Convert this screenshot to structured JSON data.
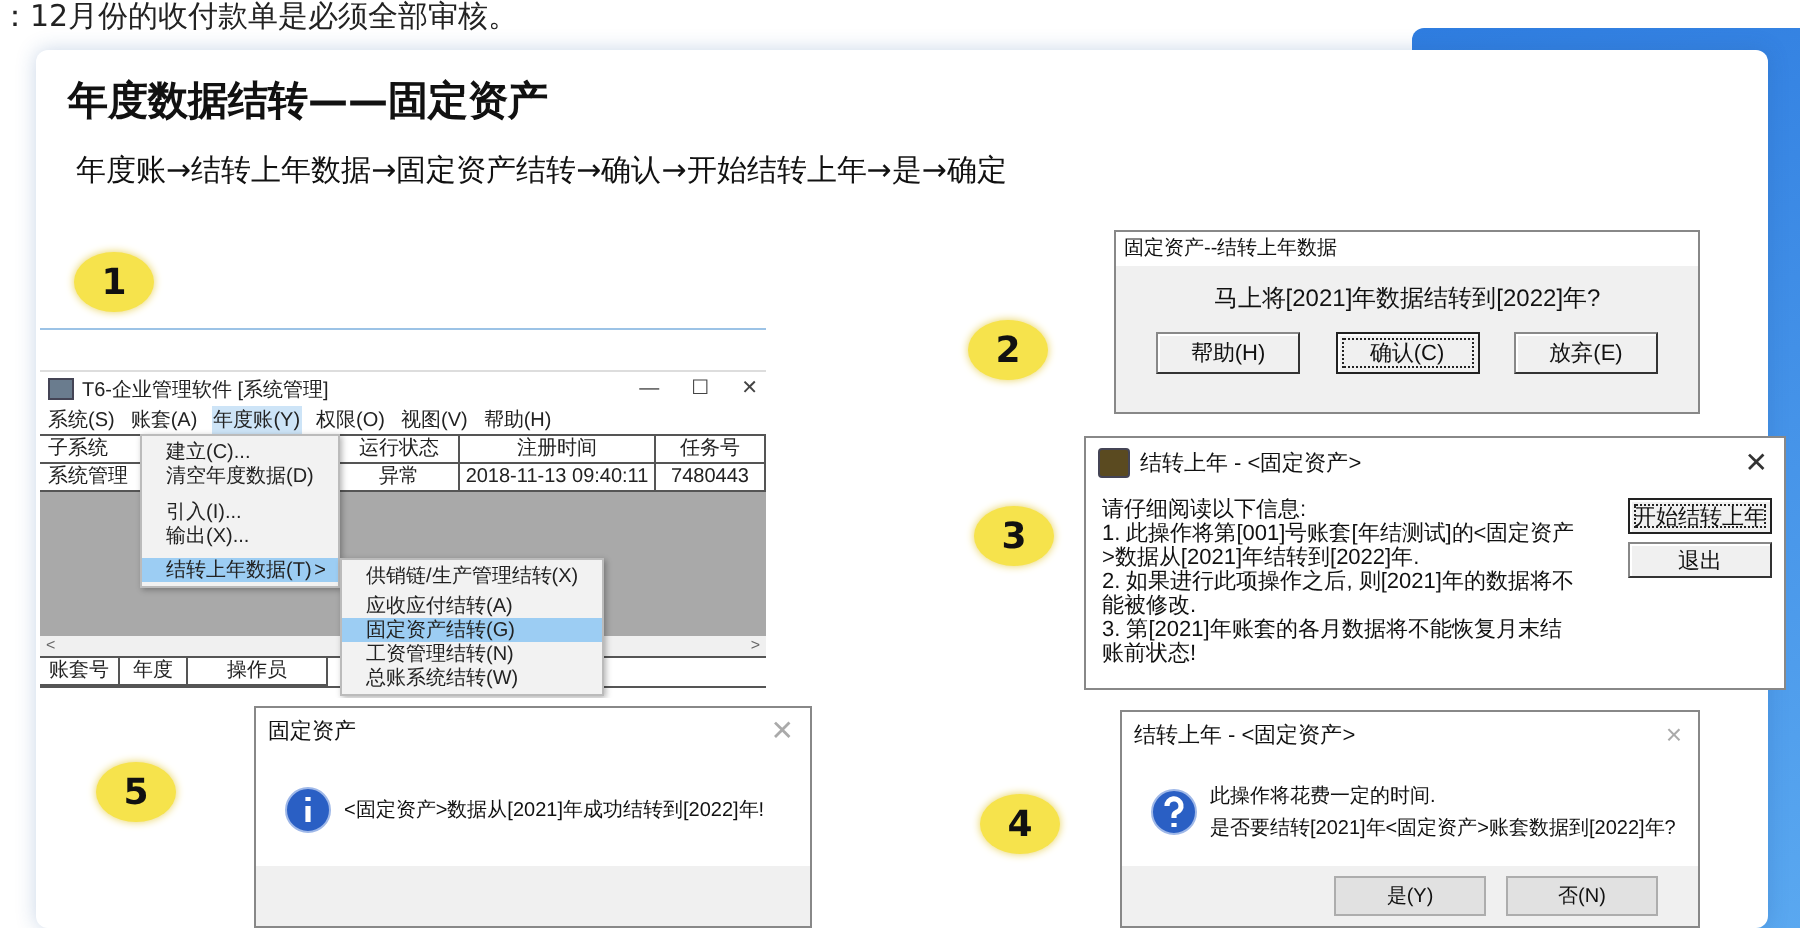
{
  "notice": "：12月份的收付款单是必须全部审核。",
  "slide": {
    "title": "年度数据结转——固定资产",
    "path": "年度账→结转上年数据→固定资产结转→确认→开始结转上年→是→确定"
  },
  "steps": [
    {
      "number": "1",
      "kind": "window",
      "title": "T6-企业管理软件 [系统管理]",
      "controls": [
        "—",
        "☐",
        "✕"
      ],
      "menubar": [
        {
          "label": "系统(S)",
          "selected": false
        },
        {
          "label": "账套(A)",
          "selected": false
        },
        {
          "label": "年度账(Y)",
          "selected": true
        },
        {
          "label": "权限(O)",
          "selected": false
        },
        {
          "label": "视图(V)",
          "selected": false
        },
        {
          "label": "帮助(H)",
          "selected": false
        }
      ],
      "table": {
        "columns": [
          "子系统",
          "运行状态",
          "注册时间",
          "任务号"
        ],
        "rows": [
          [
            "系统管理",
            "异常",
            "2018-11-13 09:40:11",
            "7480443"
          ]
        ]
      },
      "menu": [
        {
          "label": "建立(C)...",
          "selected": false
        },
        {
          "label": "清空年度数据(D)",
          "selected": false
        },
        {
          "label": "引入(I)...",
          "selected": false
        },
        {
          "label": "输出(X)...",
          "selected": false
        },
        {
          "label": "结转上年数据(T)",
          "selected": true,
          "arrow": ">"
        }
      ],
      "submenu": [
        {
          "label": "供销链/生产管理结转(X)",
          "selected": false
        },
        {
          "label": "应收应付结转(A)",
          "selected": false
        },
        {
          "label": "固定资产结转(G)",
          "selected": true
        },
        {
          "label": "工资管理结转(N)",
          "selected": false
        },
        {
          "label": "总账系统结转(W)",
          "selected": false
        }
      ],
      "scroll_marks": [
        "<",
        ">"
      ],
      "bottom_table": {
        "columns": [
          "账套号",
          "年度",
          "操作员"
        ]
      }
    },
    {
      "number": "2",
      "kind": "confirm-dialog",
      "title": "固定资产--结转上年数据",
      "lines": [
        "马上将[2021]年数据结转到[2022]年?"
      ],
      "buttons": [
        {
          "label": "帮助(H)",
          "focused": false
        },
        {
          "label": "确认(C)",
          "focused": true
        },
        {
          "label": "放弃(E)",
          "focused": false
        }
      ]
    },
    {
      "number": "3",
      "kind": "notice-dialog",
      "title": "结转上年 - <固定资产>",
      "close": "✕",
      "lines": [
        "请仔细阅读以下信息:",
        "1. 此操作将第[001]号账套[年结测试]的<固定资产>数据从[2021]年结转到[2022]年.",
        "2. 如果进行此项操作之后, 则[2021]年的数据将不能被修改.",
        "3. 第[2021]年账套的各月数据将不能恢复月末结账前状态!"
      ],
      "buttons": [
        {
          "label": "开始结转上年",
          "focused": true
        },
        {
          "label": "退出",
          "focused": false
        }
      ]
    },
    {
      "number": "5",
      "kind": "info-dialog",
      "title": "固定资产",
      "close": "✕",
      "lines": [
        "<固定资产>数据从[2021]年成功结转到[2022]年!"
      ]
    },
    {
      "number": "4",
      "kind": "question-dialog",
      "title": "结转上年 - <固定资产>",
      "close": "×",
      "lines": [
        "此操作将花费一定的时间.",
        "是否要结转[2021]年<固定资产>账套数据到[2022]年?"
      ],
      "buttons": [
        {
          "label": "是(Y)",
          "focused": false
        },
        {
          "label": "否(N)",
          "focused": false
        }
      ]
    }
  ]
}
